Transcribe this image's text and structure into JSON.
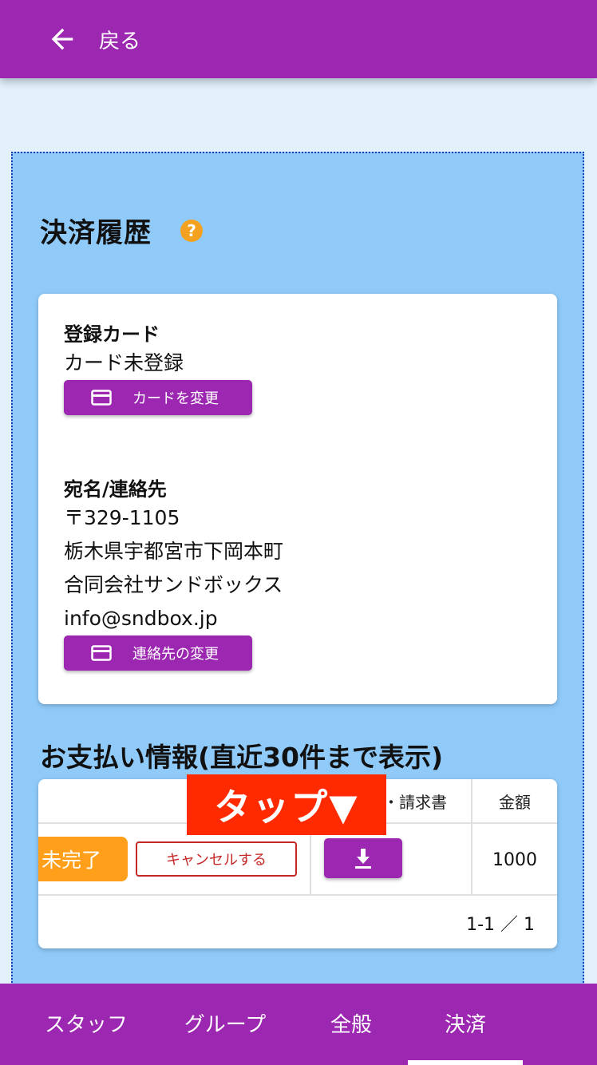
{
  "header": {
    "back_label": "戻る"
  },
  "page": {
    "title": "決済履歴",
    "help_glyph": "?"
  },
  "card_section": {
    "label": "登録カード",
    "status": "カード未登録",
    "change_button": "カードを変更"
  },
  "address_section": {
    "label": "宛名/連絡先",
    "postal": "〒329-1105",
    "address": "栃木県宇都宮市下岡本町",
    "company": "合同会社サンドボックス",
    "email": "info@sndbox.jp",
    "change_button": "連絡先の変更"
  },
  "payments": {
    "heading_prefix": "お支払い情報(直近",
    "heading_count": "30",
    "heading_suffix": "件まで表示)",
    "columns": {
      "receipt": "・請求書",
      "amount": "金額"
    },
    "rows": [
      {
        "status": "未完了",
        "cancel_label": "キャンセルする",
        "amount": "1000"
      }
    ],
    "pagination": "1-1 ／ 1"
  },
  "annotation": {
    "tap_label": "タップ▼"
  },
  "bottom_nav": {
    "items": [
      {
        "label": "スタッフ"
      },
      {
        "label": "グループ"
      },
      {
        "label": "全般"
      },
      {
        "label": "決済"
      }
    ],
    "active_index": 3
  },
  "colors": {
    "primary": "#9c27b0",
    "panel": "#90caf9",
    "background": "#e3f1fc",
    "warning": "#ff9f1a",
    "danger": "#c62828",
    "annotation": "#ff2a00"
  },
  "icons": {
    "back": "arrow-left-icon",
    "help": "help-circle-icon",
    "card": "credit-card-icon",
    "download": "download-icon"
  }
}
